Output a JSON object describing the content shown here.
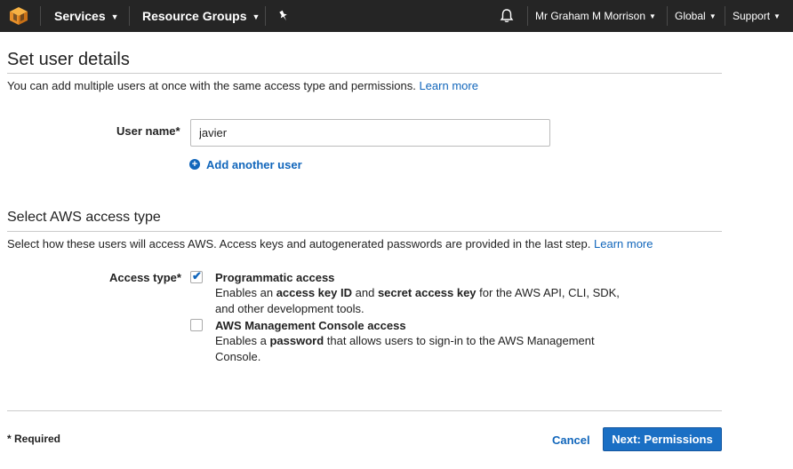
{
  "nav": {
    "services": "Services",
    "resource_groups": "Resource Groups",
    "user": "Mr Graham M Morrison",
    "region": "Global",
    "support": "Support"
  },
  "user_details": {
    "title": "Set user details",
    "description": "You can add multiple users at once with the same access type and permissions.",
    "learn_more": "Learn more",
    "user_name_label": "User name*",
    "user_name_value": "javier",
    "add_another": "Add another user"
  },
  "access": {
    "title": "Select AWS access type",
    "description": "Select how these users will access AWS. Access keys and autogenerated passwords are provided in the last step.",
    "learn_more": "Learn more",
    "access_type_label": "Access type*",
    "programmatic": {
      "title": "Programmatic access",
      "checked": true,
      "desc_1": "Enables an",
      "desc_b1": "access key ID",
      "desc_2": "and",
      "desc_b2": "secret access key",
      "desc_3": "for the AWS API, CLI, SDK, and other development tools."
    },
    "console": {
      "title": "AWS Management Console access",
      "checked": false,
      "desc_1": "Enables a",
      "desc_b1": "password",
      "desc_2": "that allows users to sign-in to the AWS Management Console."
    }
  },
  "footer": {
    "required": "* Required",
    "cancel": "Cancel",
    "next": "Next: Permissions"
  },
  "colors": {
    "nav_bg": "#252525",
    "link": "#1166bb",
    "primary_button": "#1a6fc4",
    "logo": "#f0a030"
  },
  "icons": {
    "logo": "aws-cube-icon",
    "pin": "pin-icon",
    "bell": "bell-icon",
    "add": "plus-circle-icon",
    "check": "checkmark-icon"
  }
}
